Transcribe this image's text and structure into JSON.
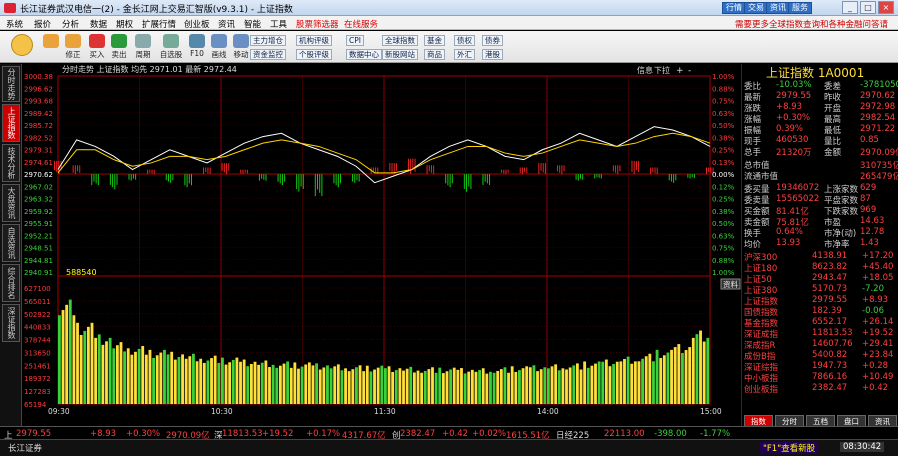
{
  "window": {
    "title": "长江证券武汉电信一(2) - 金长江网上交易汇智版(v9.3.1) - 上证指数",
    "top_buttons": [
      "行情",
      "交易",
      "资讯",
      "服务"
    ],
    "win_controls": [
      "_",
      "□",
      "×"
    ]
  },
  "menubar": {
    "items": [
      "系统",
      "报价",
      "分析",
      "数据",
      "期权",
      "扩展行情",
      "创业板",
      "资讯",
      "智能",
      "工具"
    ],
    "red_items": [
      "股票筛选器",
      "在线服务"
    ],
    "ad": "需要更多全球指数查询和各种金融问答请"
  },
  "toolbar": {
    "buttons": [
      "",
      "修正",
      "买入",
      "卖出",
      "周期",
      "自选股",
      "F10",
      "画线",
      "移动"
    ],
    "small": [
      "主力增仓",
      "机构评级",
      "CPI",
      "全球指数",
      "基金",
      "债权",
      "债券",
      "资金监控",
      "个股评级",
      "数据中心",
      "新股网站",
      "商品",
      "外汇",
      "港股"
    ]
  },
  "leftnav": {
    "items": [
      "分时走势",
      "上证指数",
      "技术分析",
      "大盘资讯",
      "自选资讯",
      "综合排名",
      "深证指数"
    ],
    "active": 1
  },
  "chart": {
    "header": "分时走势  上证指数 均先 2971.01 最新 2972.44",
    "price_labels": [
      "3000.38",
      "2996.62",
      "2993.68",
      "2989.42",
      "2985.72",
      "2982.52",
      "2979.31",
      "2974.61",
      "2970.62",
      "2967.02",
      "2963.32",
      "2959.92",
      "2955.91",
      "2952.21",
      "2948.51",
      "2944.81",
      "2940.91"
    ],
    "pct_labels": [
      "1.00%",
      "0.88%",
      "0.75%",
      "0.63%",
      "0.50%",
      "0.38%",
      "0.25%",
      "0.13%",
      "0.00%",
      "0.12%",
      "0.25%",
      "0.38%",
      "0.50%",
      "0.63%",
      "0.75%",
      "0.88%",
      "1.00%"
    ],
    "vol_labels": [
      "627100",
      "565011",
      "502922",
      "440833",
      "378744",
      "313650",
      "251461",
      "189372",
      "127283",
      "65194"
    ],
    "vol_header": "588540",
    "time_labels": [
      "09:30",
      "10:30",
      "11:30",
      "14:00",
      "15:00"
    ],
    "chip": "信息",
    "vol_chip": "资料",
    "icons": [
      "下拉",
      "+",
      "-"
    ]
  },
  "chart_data": {
    "type": "line",
    "title": "",
    "xlabel": "",
    "ylabel": "",
    "x": [
      "09:30",
      "10:30",
      "11:30",
      "14:00",
      "15:00"
    ],
    "ylim": [
      2940.91,
      3000.38
    ],
    "prev_close": 2970.62,
    "series": [
      {
        "name": "",
        "values": [
          2972,
          2981,
          2979,
          2976,
          2972,
          2975,
          2978,
          2976,
          2974,
          2977,
          2980,
          2982,
          2983,
          2980,
          2978,
          2976,
          2973,
          2968,
          2970,
          2972,
          2976,
          2979,
          2981,
          2979,
          2976,
          2975,
          2978,
          2980,
          2983,
          2981,
          2979,
          2982,
          2985,
          2984,
          2982,
          2979
        ]
      },
      {
        "name": "",
        "values": [
          2971,
          2978,
          2978,
          2975,
          2973,
          2974,
          2976,
          2976,
          2975,
          2976,
          2978,
          2980,
          2981,
          2980,
          2979,
          2977,
          2975,
          2971,
          2971,
          2972,
          2975,
          2977,
          2979,
          2979,
          2977,
          2976,
          2977,
          2979,
          2981,
          2980,
          2979,
          2980,
          2982,
          2983,
          2982,
          2980
        ]
      }
    ],
    "volume": [
      540,
      420,
      360,
      320,
      300,
      280,
      270,
      260,
      250,
      240,
      230,
      225,
      220,
      215,
      210,
      205,
      200,
      198,
      195,
      192,
      190,
      188,
      186,
      185,
      190,
      195,
      200,
      205,
      210,
      220,
      230,
      245,
      260,
      280,
      310,
      380
    ],
    "flow": [
      6,
      4,
      -5,
      -7,
      -3,
      2,
      -4,
      -6,
      3,
      5,
      2,
      -3,
      -5,
      -8,
      -10,
      -6,
      -4,
      3,
      5,
      7,
      4,
      -6,
      -8,
      -5,
      2,
      3,
      5,
      4,
      -3,
      -2,
      4,
      6,
      3,
      -4,
      -2,
      3
    ],
    "grid": true
  },
  "right": {
    "title": "上证指数 1A0001",
    "rows": [
      [
        "委比",
        "-10.03%",
        "委差",
        "-3781050"
      ],
      [
        "最新",
        "2979.55",
        "昨收",
        "2970.62"
      ],
      [
        "涨跌",
        "+8.93",
        "开盘",
        "2972.98"
      ],
      [
        "涨幅",
        "+0.30%",
        "最高",
        "2982.54"
      ],
      [
        "振幅",
        "0.39%",
        "最低",
        "2971.22"
      ],
      [
        "现手",
        "460530",
        "量比",
        "0.85"
      ],
      [
        "总手",
        "21320万",
        "金额",
        "2970.09亿"
      ]
    ],
    "rows2": [
      [
        "总市值",
        "",
        "",
        "310735亿"
      ],
      [
        "流通市值",
        "",
        "",
        "265479亿"
      ]
    ],
    "rows3": [
      [
        "委买量",
        "19346072",
        "上涨家数",
        "629"
      ],
      [
        "委卖量",
        "15565022",
        "平盘家数",
        "87"
      ],
      [
        "买金额",
        "81.41亿",
        "下跌家数",
        "969"
      ],
      [
        "卖金额",
        "75.81亿",
        "市盈",
        "14.63"
      ],
      [
        "换手",
        "0.64%",
        "市净(动)",
        "12.78"
      ],
      [
        "均价",
        "13.93",
        "市净率",
        "1.43"
      ]
    ],
    "indices": [
      [
        "沪深300",
        "4138.91",
        "+17.20"
      ],
      [
        "上证180",
        "8623.82",
        "+45.40"
      ],
      [
        "上证50",
        "2943.47",
        "+18.05"
      ],
      [
        "上证380",
        "5170.73",
        "-7.20"
      ],
      [
        "上证指数",
        "2979.55",
        "+8.93"
      ],
      [
        "国债指数",
        "182.39",
        "-0.06"
      ],
      [
        "基金指数",
        "6552.17",
        "+26.14"
      ],
      [
        "深证成指",
        "11813.53",
        "+19.52"
      ],
      [
        "深成指R",
        "14607.76",
        "+29.41"
      ],
      [
        "成份B指",
        "5400.82",
        "+23.84"
      ],
      [
        "深证综指",
        "1947.73",
        "+0.28"
      ],
      [
        "中小板指",
        "7866.16",
        "+10.49"
      ],
      [
        "创业板指",
        "2382.47",
        "+0.42"
      ]
    ],
    "tabs": [
      "指数",
      "分时",
      "五档",
      "盘口",
      "资讯"
    ]
  },
  "status": {
    "items": [
      "上",
      "2979.55",
      "+8.93",
      "+0.30%",
      "2970.09亿",
      "深",
      "11813.53",
      "+19.52",
      "+0.17%",
      "4317.67亿",
      "创",
      "2382.47",
      "+0.42",
      "+0.02%",
      "1615.51亿",
      "日经225",
      "22113.00",
      "-398.00",
      "-1.77%"
    ],
    "bottom_left": "长江证券",
    "bottom_mid": "\"F1\"查看新股",
    "clock": "08:30:42"
  }
}
